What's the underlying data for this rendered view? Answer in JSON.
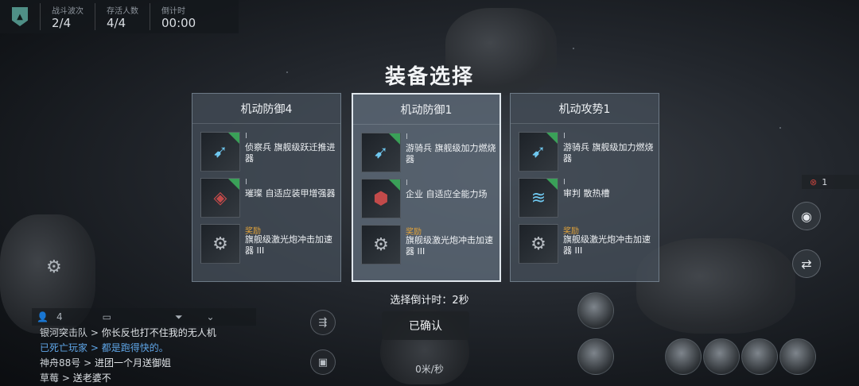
{
  "hud": {
    "wave_label": "战斗波次",
    "wave_value": "2/4",
    "alive_label": "存活人数",
    "alive_value": "4/4",
    "timer_label": "倒计时",
    "timer_value": "00:00"
  },
  "title": "装备选择",
  "cards": [
    {
      "title": "机动防御4",
      "selected": false,
      "items": [
        {
          "line1": "I",
          "line2": "侦察兵 旗舰级跃迁推进器",
          "icon": "thruster-icon",
          "tone": "blue"
        },
        {
          "line1": "I",
          "line2": "璀璨 自适应装甲增强器",
          "icon": "armor-icon",
          "tone": "red"
        },
        {
          "line1": "奖励",
          "line2": "旗舰级激光炮冲击加速器 III",
          "icon": "laser-accelerator-icon",
          "tone": "grey",
          "reward": true
        }
      ]
    },
    {
      "title": "机动防御1",
      "selected": true,
      "items": [
        {
          "line1": "I",
          "line2": "游骑兵 旗舰级加力燃烧器",
          "icon": "afterburner-icon",
          "tone": "blue"
        },
        {
          "line1": "I",
          "line2": "企业 自适应全能力场",
          "icon": "shield-field-icon",
          "tone": "red"
        },
        {
          "line1": "奖励",
          "line2": "旗舰级激光炮冲击加速器 III",
          "icon": "laser-accelerator-icon",
          "tone": "grey",
          "reward": true
        }
      ]
    },
    {
      "title": "机动攻势1",
      "selected": false,
      "items": [
        {
          "line1": "I",
          "line2": "游骑兵 旗舰级加力燃烧器",
          "icon": "afterburner-icon",
          "tone": "blue"
        },
        {
          "line1": "I",
          "line2": "审判 散热槽",
          "icon": "heat-sink-icon",
          "tone": "blue"
        },
        {
          "line1": "奖励",
          "line2": "旗舰级激光炮冲击加速器 III",
          "icon": "laser-accelerator-icon",
          "tone": "grey",
          "reward": true
        }
      ]
    }
  ],
  "countdown": "选择倒计时：2秒",
  "confirm_label": "已确认",
  "speed": "0米/秒",
  "chat": {
    "count": "4",
    "lines": [
      {
        "name": "银河突击队",
        "sep": " > ",
        "msg": "你长反也打不住我的无人机",
        "blue": false
      },
      {
        "name": "已死亡玩家",
        "sep": " > ",
        "msg": "都是跑得快的。",
        "blue": true
      },
      {
        "name": "神舟88号",
        "sep": " > ",
        "msg": "进团一个月送御姐",
        "blue": false
      },
      {
        "name": "草莓",
        "sep": " > ",
        "msg": "送老婆不",
        "blue": false
      }
    ]
  },
  "kill_count": "1"
}
